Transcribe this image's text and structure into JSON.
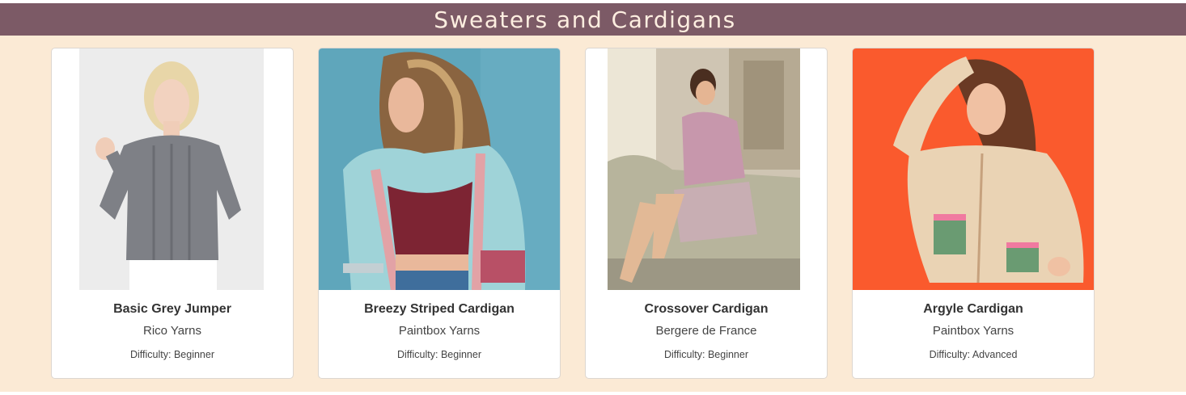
{
  "banner": {
    "title": "Sweaters and Cardigans"
  },
  "products": [
    {
      "name": "Basic Grey Jumper",
      "brand": "Rico Yarns",
      "difficulty": "Difficulty: Beginner",
      "image": "woman-grey-cable-knit-jumper"
    },
    {
      "name": "Breezy Striped Cardigan",
      "brand": "Paintbox Yarns",
      "difficulty": "Difficulty: Beginner",
      "image": "woman-blue-striped-cardigan"
    },
    {
      "name": "Crossover Cardigan",
      "brand": "Bergere de France",
      "difficulty": "Difficulty: Beginner",
      "image": "woman-pink-crossover-cardigan-on-sofa"
    },
    {
      "name": "Argyle Cardigan",
      "brand": "Paintbox Yarns",
      "difficulty": "Difficulty: Advanced",
      "image": "woman-cream-argyle-cardigan-orange-background"
    }
  ],
  "colors": {
    "banner": "#7c5a66",
    "page_background": "#fbead5",
    "card_background": "#ffffff"
  }
}
